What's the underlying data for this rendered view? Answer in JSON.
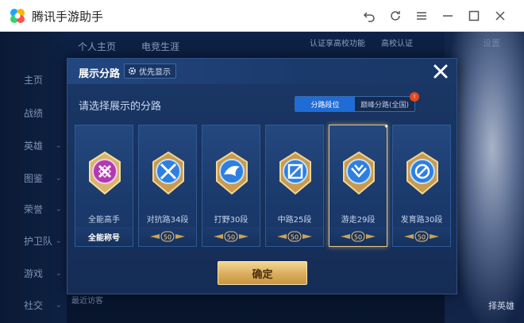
{
  "window": {
    "title": "腾讯手游助手"
  },
  "sidebar": {
    "items": [
      {
        "label": "主页",
        "has_chevron": false
      },
      {
        "label": "战绩",
        "has_chevron": false
      },
      {
        "label": "英雄",
        "has_chevron": true
      },
      {
        "label": "图鉴",
        "has_chevron": true
      },
      {
        "label": "荣誉",
        "has_chevron": true
      },
      {
        "label": "护卫队",
        "has_chevron": true
      },
      {
        "label": "游戏",
        "has_chevron": true
      },
      {
        "label": "社交",
        "has_chevron": true
      }
    ]
  },
  "background": {
    "tabs": [
      "个人主页",
      "电竞生涯"
    ],
    "top_right_text": "认证享高校功能",
    "campus_tag": "高校认证",
    "settings_label": "设置",
    "bottom_text": "最近访客",
    "hero_button": "择英雄"
  },
  "dialog": {
    "title": "展示分路",
    "priority_label": "优先显示",
    "subtitle": "请选择展示的分路",
    "toggle": {
      "options": [
        "分路段位",
        "巅峰分路(全国)"
      ],
      "active_index": 0
    },
    "confirm_label": "确定",
    "cards": [
      {
        "label": "全能高手",
        "footer": "全能称号",
        "emblem": "all-round-emblem-icon",
        "selected": false,
        "rank": ""
      },
      {
        "label": "对抗路34段",
        "footer": "",
        "emblem": "clash-lane-emblem-icon",
        "selected": false,
        "rank": "50"
      },
      {
        "label": "打野30段",
        "footer": "",
        "emblem": "jungle-emblem-icon",
        "selected": false,
        "rank": "50"
      },
      {
        "label": "中路25段",
        "footer": "",
        "emblem": "mid-lane-emblem-icon",
        "selected": false,
        "rank": "50"
      },
      {
        "label": "游走29段",
        "footer": "",
        "emblem": "roam-emblem-icon",
        "selected": true,
        "rank": "50"
      },
      {
        "label": "发育路30段",
        "footer": "",
        "emblem": "farm-lane-emblem-icon",
        "selected": false,
        "rank": "50"
      }
    ]
  },
  "colors": {
    "accent_blue": "#1f6cd6",
    "gold": "#e6c78a",
    "dialog_bg": "#1a3766"
  }
}
